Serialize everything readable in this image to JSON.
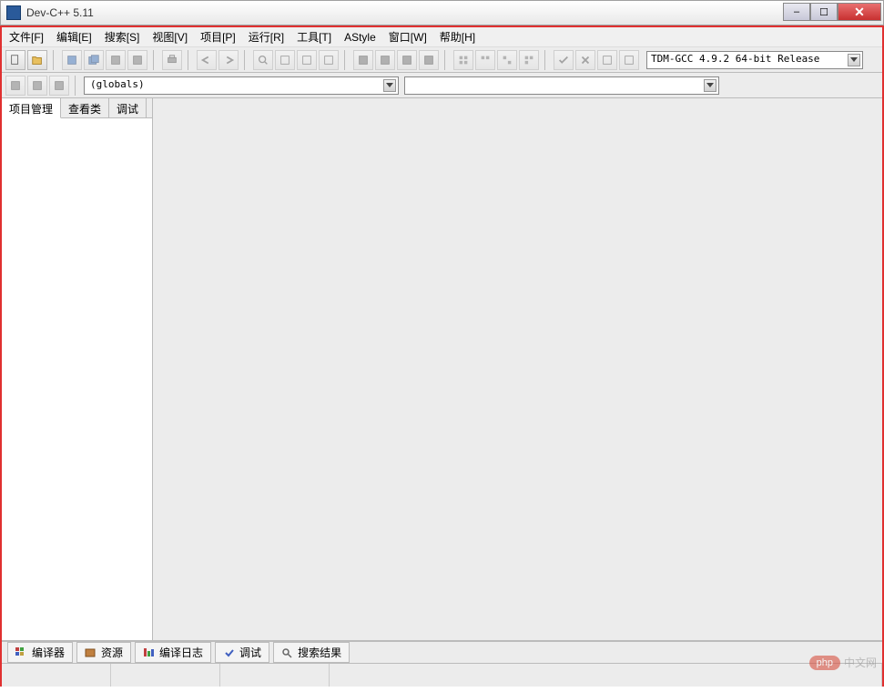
{
  "window": {
    "title": "Dev-C++ 5.11"
  },
  "menus": {
    "file": "文件[F]",
    "edit": "编辑[E]",
    "search": "搜索[S]",
    "view": "视图[V]",
    "project": "项目[P]",
    "run": "运行[R]",
    "tools": "工具[T]",
    "astyle": "AStyle",
    "window": "窗口[W]",
    "help": "帮助[H]"
  },
  "compiler": {
    "selected": "TDM-GCC 4.9.2 64-bit Release"
  },
  "scope": {
    "selected": "(globals)"
  },
  "sidebar": {
    "tabs": {
      "project": "项目管理",
      "classes": "查看类",
      "debug": "调试"
    }
  },
  "bottom": {
    "compiler": "编译器",
    "resources": "资源",
    "compile_log": "编译日志",
    "debug": "调试",
    "find_results": "搜索结果"
  },
  "watermark": {
    "badge": "php",
    "text": "中文网"
  }
}
